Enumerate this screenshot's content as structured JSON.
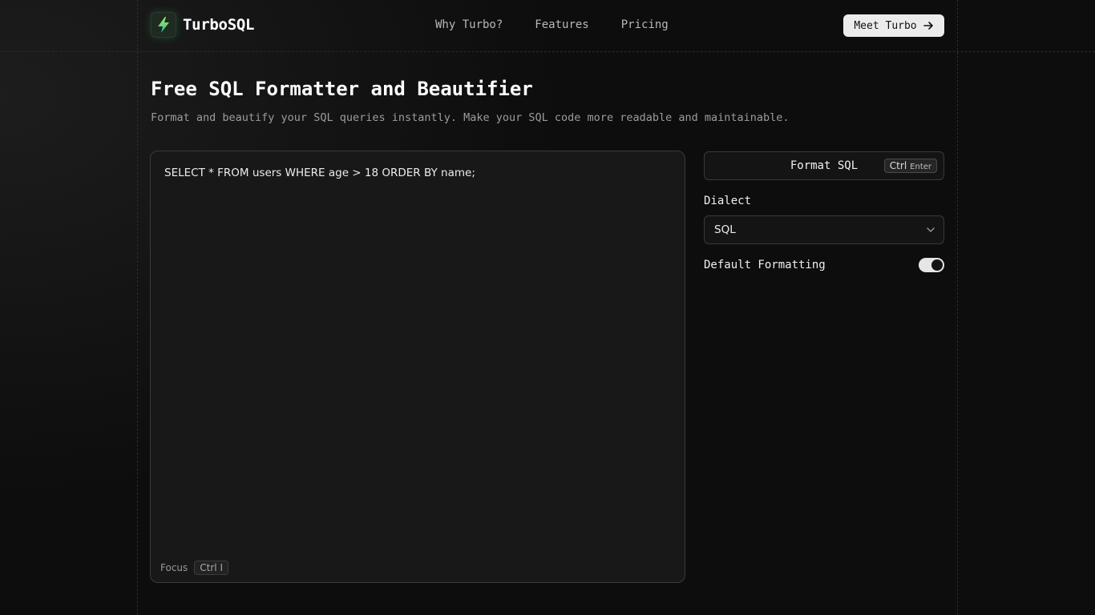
{
  "brand": {
    "name": "TurboSQL",
    "logo_icon": "lightning-bolt-icon"
  },
  "nav": [
    {
      "label": "Why Turbo?"
    },
    {
      "label": "Features"
    },
    {
      "label": "Pricing"
    }
  ],
  "cta": {
    "label": "Meet Turbo",
    "icon": "arrow-right-icon"
  },
  "page": {
    "title": "Free SQL Formatter and Beautifier",
    "subtitle": "Format and beautify your SQL queries instantly. Make your SQL code more readable and maintainable."
  },
  "editor": {
    "value": "SELECT * FROM users WHERE age > 18 ORDER BY name;",
    "focus_label": "Focus",
    "focus_shortcut": "Ctrl I"
  },
  "controls": {
    "format_label": "Format SQL",
    "format_shortcut_key1": "Ctrl",
    "format_shortcut_key2": "Enter",
    "dialect_label": "Dialect",
    "dialect_value": "SQL",
    "default_formatting_label": "Default Formatting",
    "default_formatting_on": true
  },
  "colors": {
    "background": "#0d0d0d",
    "accent_green": "#2ecc71",
    "logo_bolt": "#35d07f"
  }
}
